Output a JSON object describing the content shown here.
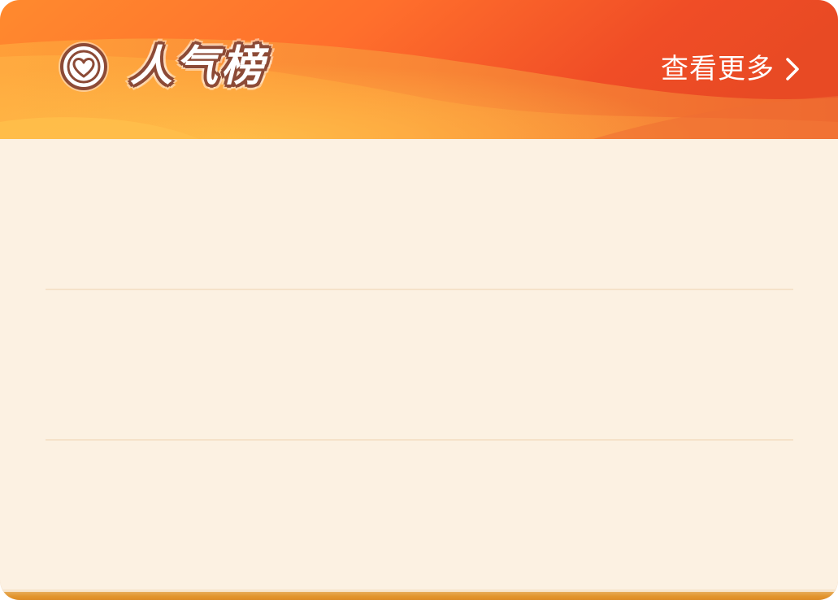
{
  "header": {
    "title": "人气榜",
    "more_label": "查看更多",
    "icons": {
      "badge": "heart-circle-icon",
      "more": "chevron-right-icon"
    }
  },
  "list": {
    "rows": [
      {},
      {},
      {}
    ]
  },
  "colors": {
    "header_orange": "#ff7a2e",
    "header_red": "#ea4a25",
    "header_yellow": "#ffb13d",
    "panel_background": "#fcf1e2",
    "divider": "#f5e2c9",
    "bottom_edge": "#e3962f",
    "title_outline": "#8c4a36"
  }
}
